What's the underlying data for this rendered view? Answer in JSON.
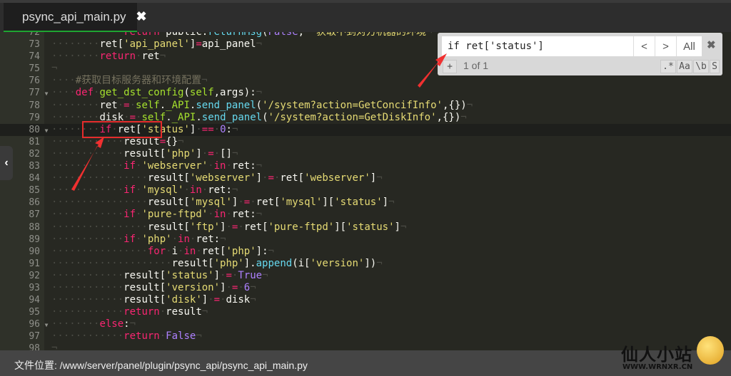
{
  "tab": {
    "title": "psync_api_main.py",
    "close": "✖",
    "icon": "python-icon"
  },
  "find": {
    "query": "if ret['status']",
    "prev": "<",
    "next": ">",
    "all": "All",
    "close": "✖",
    "add": "+",
    "count": "1 of 1",
    "regex": ".*",
    "case": "Aa",
    "word": "\\b",
    "selection": "S"
  },
  "side_toggle": "‹",
  "status": {
    "text": "文件位置: /www/server/panel/plugin/psync_api/psync_api_main.py"
  },
  "logo": {
    "name": "仙人小站",
    "url": "WWW.WRNXR.CN"
  },
  "highlight_color": "#e52c2c",
  "code": [
    {
      "n": 72,
      "i": 12,
      "tok": [
        [
          "k",
          "return"
        ],
        [
          "t",
          " public."
        ],
        [
          "f",
          "returnMsg"
        ],
        [
          "t",
          "("
        ],
        [
          "n",
          "False"
        ],
        [
          "t",
          ", "
        ],
        [
          "s",
          "'获取不到对方机器的环境"
        ]
      ]
    },
    {
      "n": 73,
      "i": 8,
      "tok": [
        [
          "t",
          "ret["
        ],
        [
          "s",
          "'api_panel'"
        ],
        [
          "t",
          "]"
        ],
        [
          "k",
          "="
        ],
        [
          "t",
          "api_panel"
        ]
      ]
    },
    {
      "n": 74,
      "i": 8,
      "tok": [
        [
          "k",
          "return"
        ],
        [
          "t",
          " ret"
        ]
      ]
    },
    {
      "n": 75,
      "i": 0,
      "tok": []
    },
    {
      "n": 76,
      "i": 4,
      "tok": [
        [
          "c",
          "#获取目标服务器和环境配置"
        ]
      ]
    },
    {
      "n": 77,
      "i": 4,
      "fold": true,
      "tok": [
        [
          "k",
          "def"
        ],
        [
          "t",
          " "
        ],
        [
          "g",
          "get_dst_config"
        ],
        [
          "t",
          "("
        ],
        [
          "g",
          "self"
        ],
        [
          "t",
          ",args):"
        ]
      ]
    },
    {
      "n": 78,
      "i": 8,
      "tok": [
        [
          "t",
          "ret "
        ],
        [
          "k",
          "="
        ],
        [
          "t",
          " "
        ],
        [
          "g",
          "self"
        ],
        [
          "t",
          "."
        ],
        [
          "g",
          "_API"
        ],
        [
          "t",
          "."
        ],
        [
          "f",
          "send_panel"
        ],
        [
          "t",
          "("
        ],
        [
          "s",
          "'/system?action=GetConcifInfo'"
        ],
        [
          "t",
          ",{})"
        ]
      ]
    },
    {
      "n": 79,
      "i": 8,
      "tok": [
        [
          "t",
          "disk "
        ],
        [
          "k",
          "="
        ],
        [
          "t",
          " "
        ],
        [
          "g",
          "self"
        ],
        [
          "t",
          "."
        ],
        [
          "g",
          "_API"
        ],
        [
          "t",
          "."
        ],
        [
          "f",
          "send_panel"
        ],
        [
          "t",
          "("
        ],
        [
          "s",
          "'/system?action=GetDiskInfo'"
        ],
        [
          "t",
          ",{})"
        ]
      ]
    },
    {
      "n": 80,
      "i": 8,
      "fold": true,
      "active": true,
      "tok": [
        [
          "k",
          "if"
        ],
        [
          "t",
          " ret["
        ],
        [
          "s",
          "'status'"
        ],
        [
          "t",
          "] "
        ],
        [
          "k",
          "=="
        ],
        [
          "t",
          " "
        ],
        [
          "n",
          "0"
        ],
        [
          "t",
          ":"
        ]
      ]
    },
    {
      "n": 81,
      "i": 12,
      "tok": [
        [
          "t",
          "result"
        ],
        [
          "k",
          "="
        ],
        [
          "t",
          "{}"
        ]
      ]
    },
    {
      "n": 82,
      "i": 12,
      "tok": [
        [
          "t",
          "result["
        ],
        [
          "s",
          "'php'"
        ],
        [
          "t",
          "] "
        ],
        [
          "k",
          "="
        ],
        [
          "t",
          " []"
        ]
      ]
    },
    {
      "n": 83,
      "i": 12,
      "tok": [
        [
          "k",
          "if"
        ],
        [
          "t",
          " "
        ],
        [
          "s",
          "'webserver'"
        ],
        [
          "t",
          " "
        ],
        [
          "k",
          "in"
        ],
        [
          "t",
          " ret:"
        ]
      ]
    },
    {
      "n": 84,
      "i": 16,
      "tok": [
        [
          "t",
          "result["
        ],
        [
          "s",
          "'webserver'"
        ],
        [
          "t",
          "] "
        ],
        [
          "k",
          "="
        ],
        [
          "t",
          " ret["
        ],
        [
          "s",
          "'webserver'"
        ],
        [
          "t",
          "]"
        ]
      ]
    },
    {
      "n": 85,
      "i": 12,
      "tok": [
        [
          "k",
          "if"
        ],
        [
          "t",
          " "
        ],
        [
          "s",
          "'mysql'"
        ],
        [
          "t",
          " "
        ],
        [
          "k",
          "in"
        ],
        [
          "t",
          " ret:"
        ]
      ]
    },
    {
      "n": 86,
      "i": 16,
      "tok": [
        [
          "t",
          "result["
        ],
        [
          "s",
          "'mysql'"
        ],
        [
          "t",
          "] "
        ],
        [
          "k",
          "="
        ],
        [
          "t",
          " ret["
        ],
        [
          "s",
          "'mysql'"
        ],
        [
          "t",
          "]["
        ],
        [
          "s",
          "'status'"
        ],
        [
          "t",
          "]"
        ]
      ]
    },
    {
      "n": 87,
      "i": 12,
      "tok": [
        [
          "k",
          "if"
        ],
        [
          "t",
          " "
        ],
        [
          "s",
          "'pure-ftpd'"
        ],
        [
          "t",
          " "
        ],
        [
          "k",
          "in"
        ],
        [
          "t",
          " ret:"
        ]
      ]
    },
    {
      "n": 88,
      "i": 16,
      "tok": [
        [
          "t",
          "result["
        ],
        [
          "s",
          "'ftp'"
        ],
        [
          "t",
          "] "
        ],
        [
          "k",
          "="
        ],
        [
          "t",
          " ret["
        ],
        [
          "s",
          "'pure-ftpd'"
        ],
        [
          "t",
          "]["
        ],
        [
          "s",
          "'status'"
        ],
        [
          "t",
          "]"
        ]
      ]
    },
    {
      "n": 89,
      "i": 12,
      "tok": [
        [
          "k",
          "if"
        ],
        [
          "t",
          " "
        ],
        [
          "s",
          "'php'"
        ],
        [
          "t",
          " "
        ],
        [
          "k",
          "in"
        ],
        [
          "t",
          " ret:"
        ]
      ]
    },
    {
      "n": 90,
      "i": 16,
      "tok": [
        [
          "k",
          "for"
        ],
        [
          "t",
          " i "
        ],
        [
          "k",
          "in"
        ],
        [
          "t",
          " ret["
        ],
        [
          "s",
          "'php'"
        ],
        [
          "t",
          "]:"
        ]
      ]
    },
    {
      "n": 91,
      "i": 20,
      "tok": [
        [
          "t",
          "result["
        ],
        [
          "s",
          "'php'"
        ],
        [
          "t",
          "]."
        ],
        [
          "f",
          "append"
        ],
        [
          "t",
          "(i["
        ],
        [
          "s",
          "'version'"
        ],
        [
          "t",
          "])"
        ]
      ]
    },
    {
      "n": 92,
      "i": 12,
      "tok": [
        [
          "t",
          "result["
        ],
        [
          "s",
          "'status'"
        ],
        [
          "t",
          "] "
        ],
        [
          "k",
          "="
        ],
        [
          "t",
          " "
        ],
        [
          "n",
          "True"
        ]
      ]
    },
    {
      "n": 93,
      "i": 12,
      "tok": [
        [
          "t",
          "result["
        ],
        [
          "s",
          "'version'"
        ],
        [
          "t",
          "] "
        ],
        [
          "k",
          "="
        ],
        [
          "t",
          " "
        ],
        [
          "n",
          "6"
        ]
      ]
    },
    {
      "n": 94,
      "i": 12,
      "tok": [
        [
          "t",
          "result["
        ],
        [
          "s",
          "'disk'"
        ],
        [
          "t",
          "] "
        ],
        [
          "k",
          "="
        ],
        [
          "t",
          " disk"
        ]
      ]
    },
    {
      "n": 95,
      "i": 12,
      "tok": [
        [
          "k",
          "return"
        ],
        [
          "t",
          " result"
        ]
      ]
    },
    {
      "n": 96,
      "i": 8,
      "fold": true,
      "tok": [
        [
          "k",
          "else"
        ],
        [
          "t",
          ":"
        ]
      ]
    },
    {
      "n": 97,
      "i": 12,
      "tok": [
        [
          "k",
          "return"
        ],
        [
          "t",
          " "
        ],
        [
          "n",
          "False"
        ]
      ]
    },
    {
      "n": 98,
      "i": 0,
      "tok": []
    }
  ]
}
